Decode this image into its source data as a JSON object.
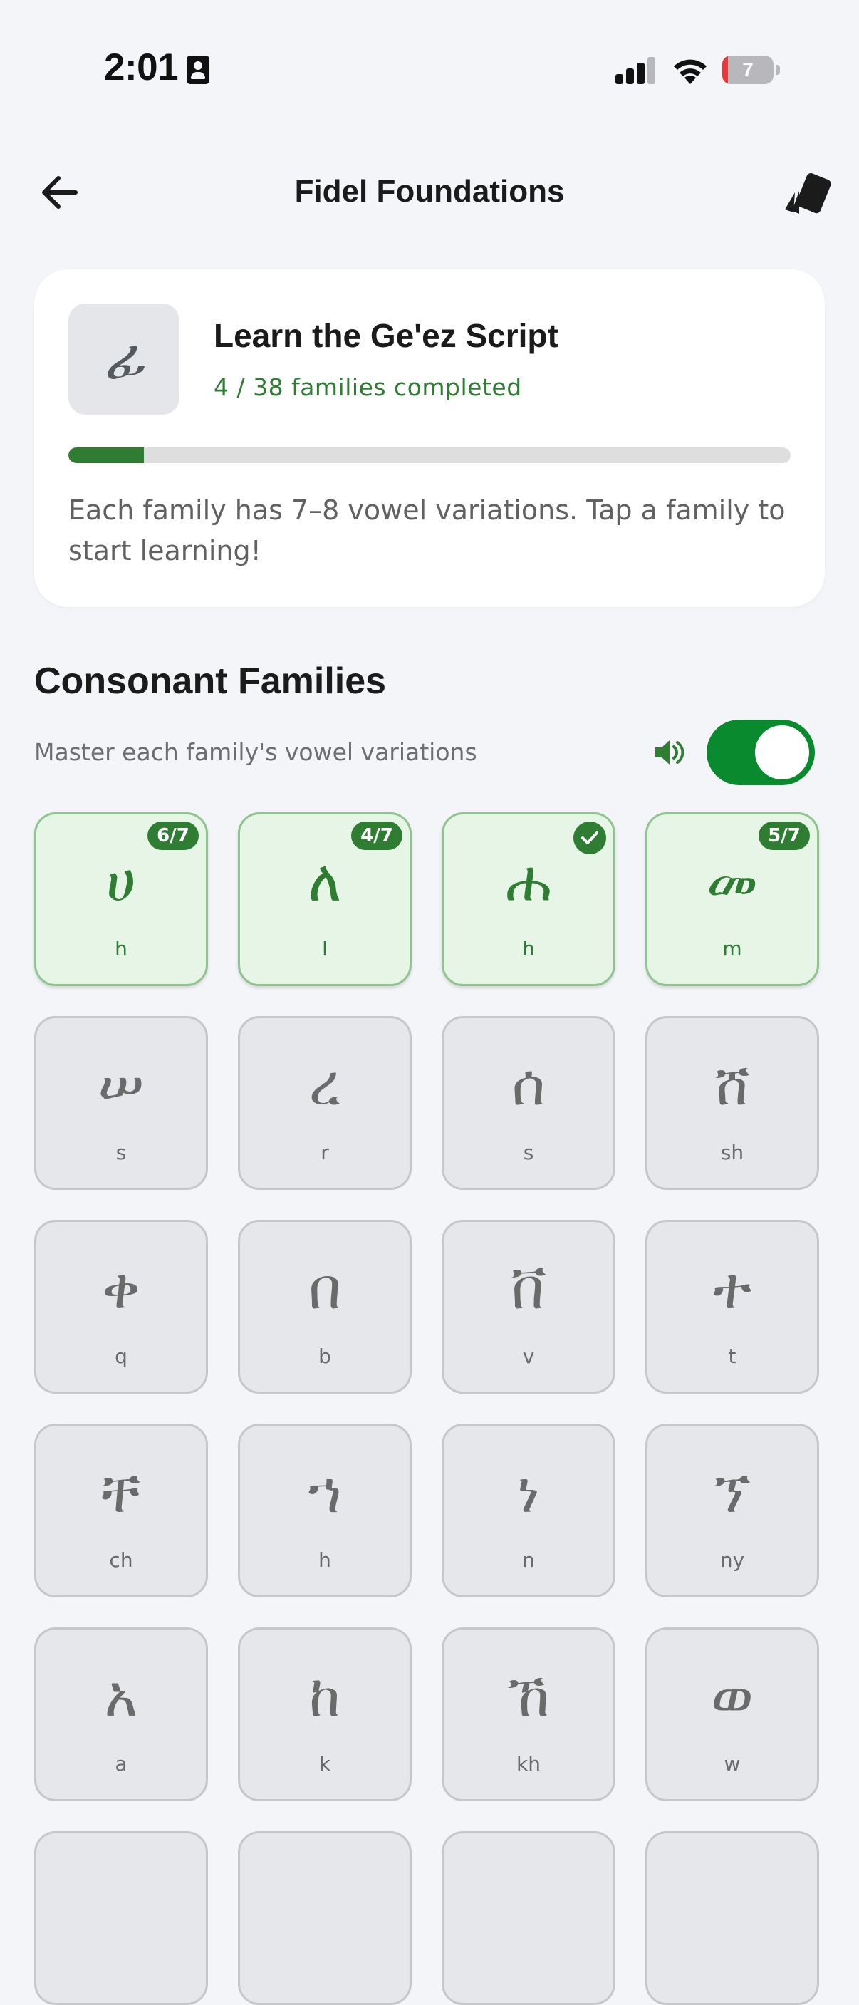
{
  "status_bar": {
    "time": "2:01",
    "battery_level": "7"
  },
  "app_bar": {
    "title": "Fidel Foundations"
  },
  "progress_card": {
    "icon_glyph": "ፊ",
    "title": "Learn the Ge'ez Script",
    "subtitle": "4 / 38 families completed",
    "progress_fraction": 0.105,
    "description": "Each family has 7–8 vowel variations. Tap a family to start learning!"
  },
  "section": {
    "title": "Consonant Families",
    "subtitle": "Master each family's vowel variations",
    "sound_enabled": true
  },
  "families": [
    {
      "glyph": "ሀ",
      "roman": "h",
      "status": "in-progress",
      "badge": "6/7"
    },
    {
      "glyph": "ለ",
      "roman": "l",
      "status": "in-progress",
      "badge": "4/7"
    },
    {
      "glyph": "ሐ",
      "roman": "h",
      "status": "completed",
      "badge": ""
    },
    {
      "glyph": "መ",
      "roman": "m",
      "status": "in-progress",
      "badge": "5/7"
    },
    {
      "glyph": "ሠ",
      "roman": "s",
      "status": "locked",
      "badge": ""
    },
    {
      "glyph": "ረ",
      "roman": "r",
      "status": "locked",
      "badge": ""
    },
    {
      "glyph": "ሰ",
      "roman": "s",
      "status": "locked",
      "badge": ""
    },
    {
      "glyph": "ሸ",
      "roman": "sh",
      "status": "locked",
      "badge": ""
    },
    {
      "glyph": "ቀ",
      "roman": "q",
      "status": "locked",
      "badge": ""
    },
    {
      "glyph": "በ",
      "roman": "b",
      "status": "locked",
      "badge": ""
    },
    {
      "glyph": "ቨ",
      "roman": "v",
      "status": "locked",
      "badge": ""
    },
    {
      "glyph": "ተ",
      "roman": "t",
      "status": "locked",
      "badge": ""
    },
    {
      "glyph": "ቸ",
      "roman": "ch",
      "status": "locked",
      "badge": ""
    },
    {
      "glyph": "ኀ",
      "roman": "h",
      "status": "locked",
      "badge": ""
    },
    {
      "glyph": "ነ",
      "roman": "n",
      "status": "locked",
      "badge": ""
    },
    {
      "glyph": "ኘ",
      "roman": "ny",
      "status": "locked",
      "badge": ""
    },
    {
      "glyph": "አ",
      "roman": "a",
      "status": "locked",
      "badge": ""
    },
    {
      "glyph": "ከ",
      "roman": "k",
      "status": "locked",
      "badge": ""
    },
    {
      "glyph": "ኸ",
      "roman": "kh",
      "status": "locked",
      "badge": ""
    },
    {
      "glyph": "ወ",
      "roman": "w",
      "status": "locked",
      "badge": ""
    },
    {
      "glyph": "",
      "roman": "",
      "status": "locked",
      "badge": ""
    },
    {
      "glyph": "",
      "roman": "",
      "status": "locked",
      "badge": ""
    },
    {
      "glyph": "",
      "roman": "",
      "status": "locked",
      "badge": ""
    },
    {
      "glyph": "",
      "roman": "",
      "status": "locked",
      "badge": ""
    }
  ],
  "colors": {
    "accent_green": "#2e7d32",
    "toggle_green": "#0a8a2e",
    "active_tile_bg": "#e6f5e6",
    "locked_tile_bg": "#e6e7eb",
    "page_bg": "#f4f5f9"
  },
  "icons": {
    "back": "arrow-left-icon",
    "cards": "flashcards-icon",
    "sound": "speaker-icon",
    "completed": "checkmark-icon"
  }
}
